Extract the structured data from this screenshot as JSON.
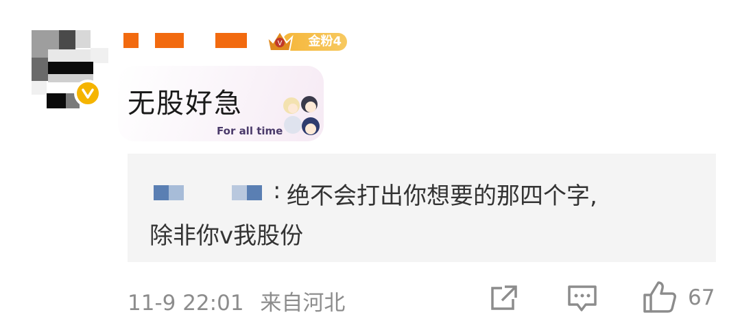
{
  "comment": {
    "user": {
      "avatar_icon": "pixelated-avatar",
      "verified_icon": "verified-badge-icon",
      "name_redacted": true,
      "fan_badge": {
        "icon": "crown-icon",
        "label": "金粉4"
      }
    },
    "text": "无股好急",
    "sticker": {
      "icon": "chibi-sticker",
      "caption": "For all time"
    },
    "reply": {
      "author_redacted": true,
      "separator": ":",
      "line1": "绝不会打出你想要的那四个字,",
      "line2": "除非你v我股份"
    },
    "footer": {
      "time": "11-9 22:01",
      "location": "来自河北",
      "share_icon": "share-icon",
      "comment_icon": "comment-icon",
      "like_icon": "thumbs-up-icon",
      "like_count": "67"
    }
  },
  "colors": {
    "accent_orange": "#f26a0f",
    "gold": "#f5b400",
    "muted_text": "#8c8c8c",
    "reply_bg": "#f4f4f4"
  }
}
